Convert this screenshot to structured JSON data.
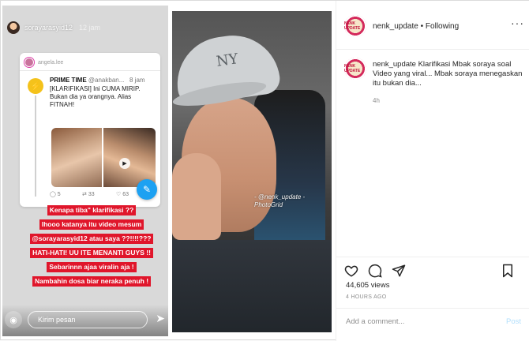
{
  "story": {
    "username": "sorayarasyid12",
    "time": "12 jam",
    "card_user": "angela.lee",
    "tweet": {
      "account": "PRIME TIME",
      "handle": "@anakban...",
      "time": "8 jam",
      "text": "[KLARIFIKASI] Ini CUMA MIRIP. Bukan dia ya orangnya. Alias FITNAH!",
      "replies": "5",
      "retweets": "33",
      "likes": "63"
    },
    "red_lines": [
      "Kenapa tiba\" klarifikasi ??",
      "lhooo katanya itu video mesum",
      "@sorayarasyid12 atau saya ??!!!!???",
      "HATI-HATI! UU ITE MENANTI GUYS !!",
      "Sebarinnn ajaa viralin aja !",
      "Nambahin dosa biar neraka penuh !"
    ],
    "reply_placeholder": "Kirim pesan"
  },
  "video": {
    "watermark_handle": "@nenk_update",
    "watermark_app": "PhotoGrid",
    "cap_logo": "NY"
  },
  "post": {
    "avatar_text": "NENK UPDATE",
    "username": "nenk_update",
    "follow_label": "Following",
    "caption_user": "nenk_update",
    "caption": "Klarifikasi Mbak soraya soal Video yang viral... Mbak soraya menegaskan itu bukan dia...",
    "caption_time": "4h",
    "views": "44,605 views",
    "time_ago": "4 HOURS AGO",
    "comment_placeholder": "Add a comment...",
    "post_label": "Post"
  },
  "icons": {
    "more": "more-icon",
    "like": "heart-icon",
    "comment": "comment-icon",
    "share": "share-icon",
    "save": "bookmark-icon",
    "camera": "camera-icon",
    "send": "send-icon"
  }
}
